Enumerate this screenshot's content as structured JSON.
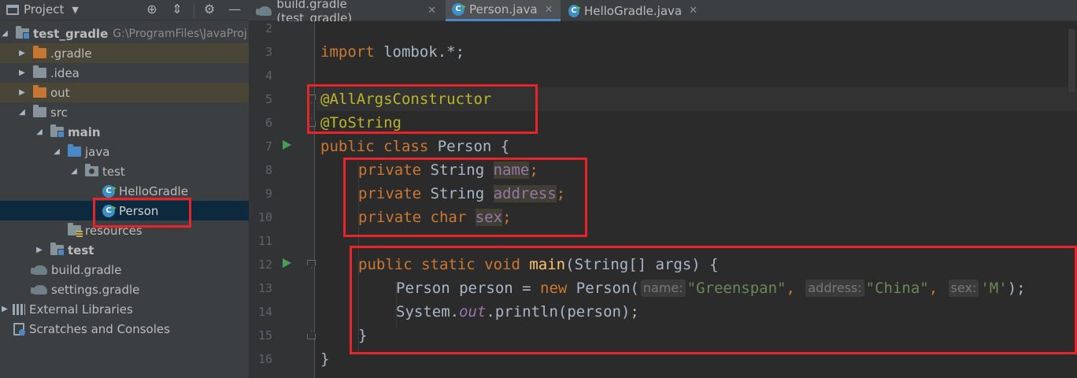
{
  "project_panel": {
    "title": "Project",
    "tree": [
      {
        "label": "test_gradle",
        "path": "G:\\ProgramFiles\\JavaProj",
        "bold": true
      },
      {
        "label": ".gradle"
      },
      {
        "label": ".idea"
      },
      {
        "label": "out"
      },
      {
        "label": "src"
      },
      {
        "label": "main",
        "bold": true
      },
      {
        "label": "java"
      },
      {
        "label": "test"
      },
      {
        "label": "HelloGradle"
      },
      {
        "label": "Person"
      },
      {
        "label": "resources"
      },
      {
        "label": "test",
        "bold": true
      },
      {
        "label": "build.gradle"
      },
      {
        "label": "settings.gradle"
      },
      {
        "label": "External Libraries"
      },
      {
        "label": "Scratches and Consoles"
      }
    ]
  },
  "tabs": [
    {
      "label": "build.gradle (test_gradle)"
    },
    {
      "label": "Person.java"
    },
    {
      "label": "HelloGradle.java"
    }
  ],
  "editor": {
    "line_numbers": [
      "2",
      "3",
      "4",
      "5",
      "6",
      "7",
      "8",
      "9",
      "10",
      "11",
      "12",
      "13",
      "14",
      "15",
      "16"
    ],
    "code": {
      "l3_kw": "import",
      "l3_rest": " lombok.*;",
      "l5": "@AllArgsConstructor",
      "l6": "@ToString",
      "l7_kw": "public class",
      "l7_rest": " Person {",
      "l8_kw": "private",
      "l8_type": " String ",
      "l8_field": "name",
      "l9_kw": "private",
      "l9_type": " String ",
      "l9_field": "address",
      "l10_kw": "private char",
      "l10_field": "sex",
      "l12_kw": "public static void",
      "l12_method": "main",
      "l12_rest": "(String[] args) {",
      "l13_a": "Person person = ",
      "l13_new": "new",
      "l13_b": " Person(",
      "l13_hint1": "name:",
      "l13_str1": "\"Greenspan\"",
      "l13_hint2": "address:",
      "l13_str2": "\"China\"",
      "l13_hint3": "sex:",
      "l13_str3": "'M'",
      "l13_end": ");",
      "l14_a": "System.",
      "l14_out": "out",
      "l14_b": ".println(person);",
      "l15": "}",
      "l16": "}"
    }
  },
  "colors": {
    "keyword": "#cc7832",
    "annotation": "#bbb529",
    "field": "#9876aa",
    "string": "#6a8759",
    "annotation_box": "#e8242a"
  }
}
